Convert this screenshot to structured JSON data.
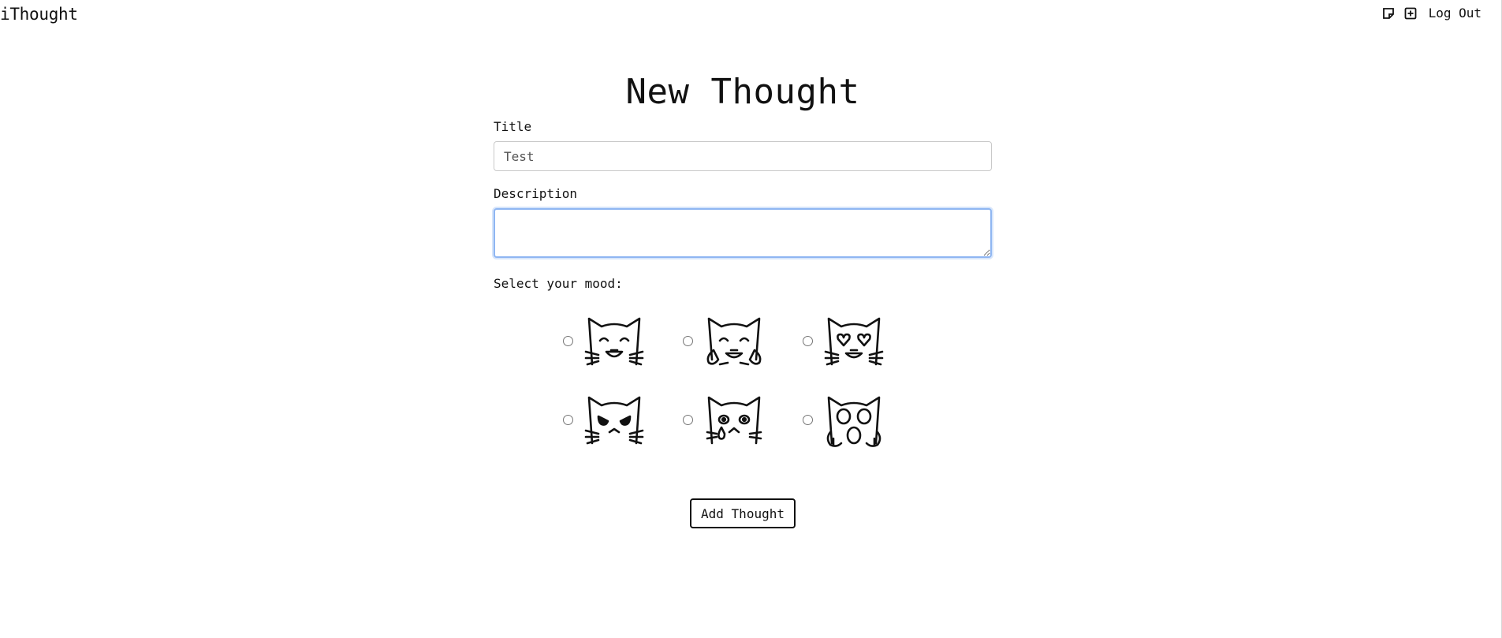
{
  "header": {
    "brand": "iThought",
    "logout_label": "Log Out",
    "icons": [
      "sticky-note-icon",
      "plus-square-icon"
    ]
  },
  "page": {
    "title": "New Thought"
  },
  "form": {
    "title_label": "Title",
    "title_value": "Test",
    "description_label": "Description",
    "description_value": "",
    "mood_label": "Select your mood:",
    "moods": [
      {
        "icon": "cat-laughing-icon",
        "selected": false
      },
      {
        "icon": "cat-tears-of-joy-icon",
        "selected": false
      },
      {
        "icon": "cat-heart-eyes-icon",
        "selected": false
      },
      {
        "icon": "cat-angry-icon",
        "selected": false
      },
      {
        "icon": "cat-crying-icon",
        "selected": false
      },
      {
        "icon": "cat-weary-icon",
        "selected": false
      }
    ],
    "submit_label": "Add Thought"
  },
  "colors": {
    "text": "#111111",
    "focus_border": "#8fb6f2",
    "input_border": "#c9c9c9"
  }
}
